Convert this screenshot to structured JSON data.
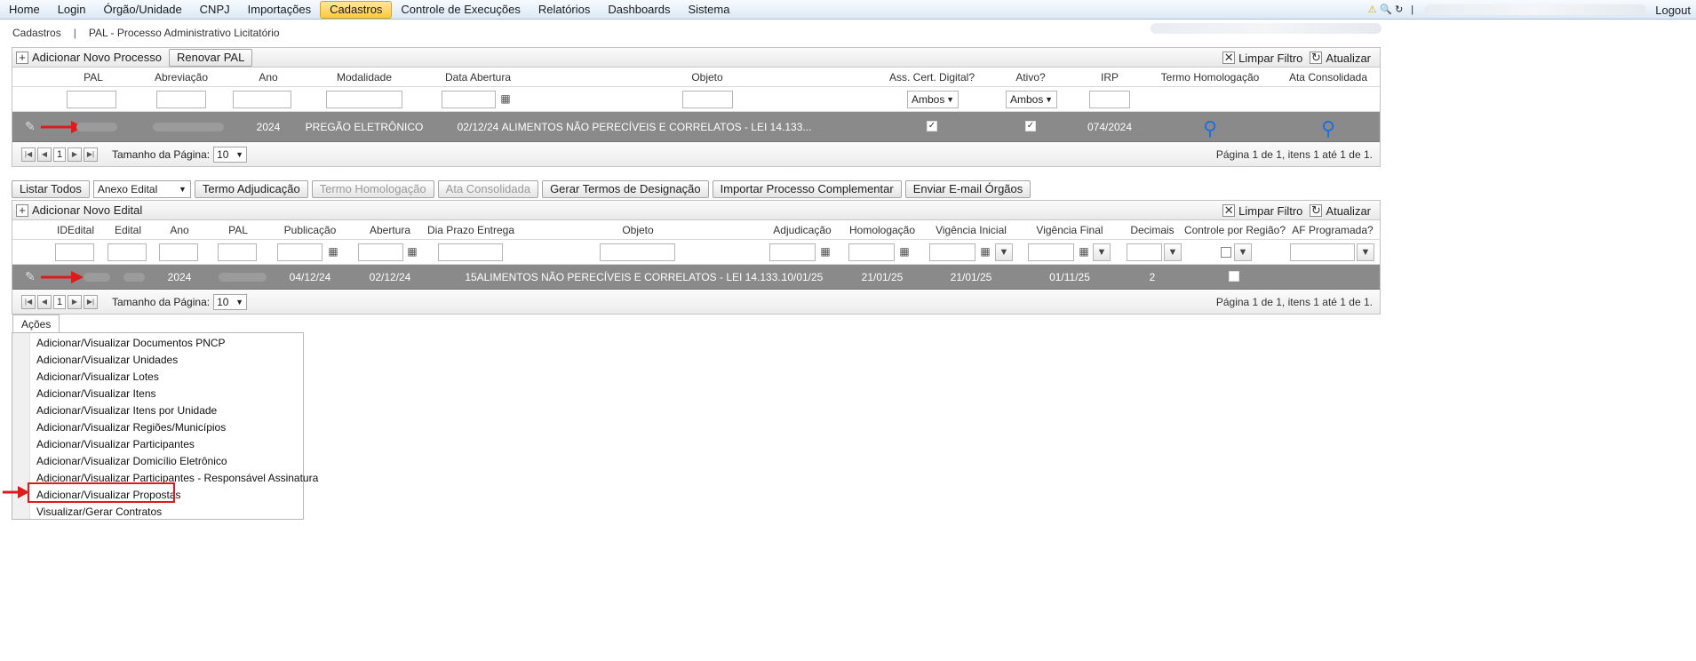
{
  "menu": {
    "items": [
      "Home",
      "Login",
      "Órgão/Unidade",
      "CNPJ",
      "Importações",
      "Cadastros",
      "Controle de Execuções",
      "Relatórios",
      "Dashboards",
      "Sistema"
    ],
    "active": "Cadastros",
    "logout": "Logout",
    "separator": "|"
  },
  "breadcrumb": {
    "root": "Cadastros",
    "separator": "|",
    "current": "PAL - Processo Administrativo Licitatório"
  },
  "grid1": {
    "add_label": "Adicionar Novo Processo",
    "renovar_label": "Renovar PAL",
    "clear_filter_label": "Limpar Filtro",
    "refresh_label": "Atualizar",
    "headers": {
      "pal": "PAL",
      "abreviacao": "Abreviação",
      "ano": "Ano",
      "modalidade": "Modalidade",
      "data_abertura": "Data Abertura",
      "objeto": "Objeto",
      "ass_cert": "Ass. Cert. Digital?",
      "ativo": "Ativo?",
      "irp": "IRP",
      "termo_hom": "Termo Homologação",
      "ata_cons": "Ata Consolidada"
    },
    "filters": {
      "ass_cert": "Ambos",
      "ativo": "Ambos"
    },
    "row": {
      "ano": "2024",
      "modalidade": "PREGÃO ELETRÔNICO",
      "data_abertura": "02/12/24",
      "objeto": "ALIMENTOS NÃO PERECÍVEIS E CORRELATOS - LEI 14.133...",
      "irp": "074/2024",
      "ass_cert_checked": true,
      "ativo_checked": true
    },
    "pager": {
      "page": "1",
      "size_label": "Tamanho da Página:",
      "size": "10",
      "info": "Página 1 de 1, itens 1 até 1 de 1."
    }
  },
  "actions_bar": {
    "listar_todos": "Listar Todos",
    "anexo_select": "Anexo Edital",
    "termo_adj": "Termo Adjudicação",
    "termo_hom": "Termo Homologação",
    "ata_cons": "Ata Consolidada",
    "gerar_termos": "Gerar Termos de Designação",
    "importar": "Importar Processo Complementar",
    "enviar_email": "Enviar E-mail Órgãos"
  },
  "grid2": {
    "add_label": "Adicionar Novo Edital",
    "clear_filter_label": "Limpar Filtro",
    "refresh_label": "Atualizar",
    "headers": {
      "idedital": "IDEdital",
      "edital": "Edital",
      "ano": "Ano",
      "pal": "PAL",
      "publicacao": "Publicação",
      "abertura": "Abertura",
      "dia_prazo": "Dia Prazo Entrega",
      "objeto": "Objeto",
      "adjudicacao": "Adjudicação",
      "homologacao": "Homologação",
      "vig_inicial": "Vigência Inicial",
      "vig_final": "Vigência Final",
      "decimais": "Decimais",
      "controle_regiao": "Controle por Região?",
      "af_programada": "AF Programada?"
    },
    "row": {
      "ano": "2024",
      "publicacao": "04/12/24",
      "abertura": "02/12/24",
      "dia_prazo": "15",
      "objeto": "ALIMENTOS NÃO PERECÍVEIS E CORRELATOS - LEI 14.133...",
      "adjudicacao": "10/01/25",
      "homologacao": "21/01/25",
      "vig_inicial": "21/01/25",
      "vig_final": "01/11/25",
      "decimais": "2"
    },
    "pager": {
      "page": "1",
      "size_label": "Tamanho da Página:",
      "size": "10",
      "info": "Página 1 de 1, itens 1 até 1 de 1."
    }
  },
  "acoes": {
    "tab_label": "Ações",
    "items": [
      "Adicionar/Visualizar Documentos PNCP",
      "Adicionar/Visualizar Unidades",
      "Adicionar/Visualizar Lotes",
      "Adicionar/Visualizar Itens",
      "Adicionar/Visualizar Itens por Unidade",
      "Adicionar/Visualizar Regiões/Municípios",
      "Adicionar/Visualizar Participantes",
      "Adicionar/Visualizar Domicílio Eletrônico",
      "Adicionar/Visualizar Participantes - Responsável Assinatura",
      "Adicionar/Visualizar Propostas",
      "Visualizar/Gerar Contratos"
    ],
    "highlighted_index": 9
  },
  "colors": {
    "annotation_red": "#e01a1a",
    "row_selected": "#8a8a8a",
    "link_blue": "#1e6fe0"
  }
}
